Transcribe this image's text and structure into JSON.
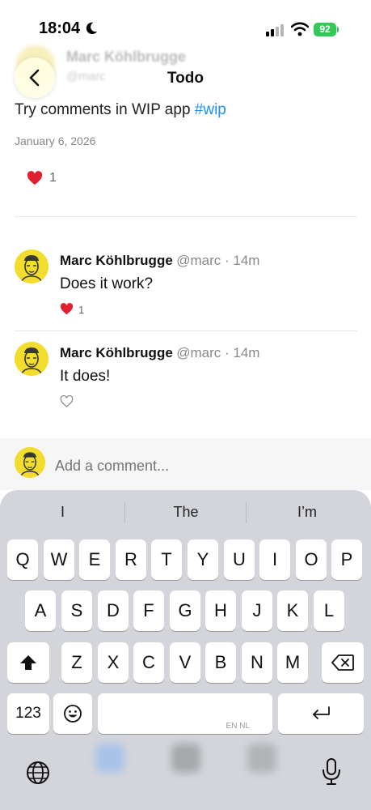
{
  "status": {
    "time": "18:04",
    "battery": "92"
  },
  "header": {
    "title": "Todo",
    "ghost_name": "Marc Köhlbrugge",
    "ghost_handle": "@marc"
  },
  "post": {
    "text": "Try comments in WIP app ",
    "hashtag": "#wip",
    "date": "January 6, 2026",
    "like_count": "1"
  },
  "comments": [
    {
      "name": "Marc Köhlbrugge",
      "meta": "@marc · 14m",
      "body": "Does it work?",
      "like_count": "1",
      "liked": true
    },
    {
      "name": "Marc Köhlbrugge",
      "meta": "@marc · 14m",
      "body": "It does!",
      "like_count": "",
      "liked": false
    }
  ],
  "compose": {
    "placeholder": "Add a comment..."
  },
  "keyboard": {
    "suggestions": [
      "I",
      "The",
      "I’m"
    ],
    "row1": [
      "Q",
      "W",
      "E",
      "R",
      "T",
      "Y",
      "U",
      "I",
      "O",
      "P"
    ],
    "row2": [
      "A",
      "S",
      "D",
      "F",
      "G",
      "H",
      "J",
      "K",
      "L"
    ],
    "row3": [
      "Z",
      "X",
      "C",
      "V",
      "B",
      "N",
      "M"
    ],
    "numbers_label": "123",
    "space_sublabel": "EN NL"
  },
  "colors": {
    "like": "#e0202e",
    "hashtag": "#1d8ff0",
    "avatar_bg": "#f2dc2e",
    "battery": "#34c759"
  }
}
